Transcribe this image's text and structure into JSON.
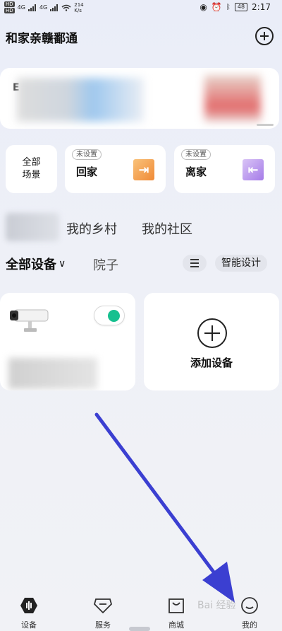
{
  "status_bar": {
    "hd1": "HD",
    "hd2": "HD",
    "net1": "4G",
    "net2": "4G",
    "speed_value": "214",
    "speed_unit": "K/s",
    "battery": "48",
    "time": "2:17"
  },
  "header": {
    "title": "和家亲赣鄱通"
  },
  "banner": {
    "letter": "E"
  },
  "scenes": {
    "all_line1": "全部",
    "all_line2": "场景",
    "home_badge": "未设置",
    "home_label": "回家",
    "leave_badge": "未设置",
    "leave_label": "离家"
  },
  "spaces": {
    "village": "我的乡村",
    "community": "我的社区"
  },
  "device_filter": {
    "all_devices": "全部设备",
    "room": "院子",
    "smart_design": "智能设计"
  },
  "devices": {
    "camera_toggle_on": true,
    "add_label": "添加设备"
  },
  "tabbar": {
    "devices": "设备",
    "service": "服务",
    "mall": "商城",
    "mine": "我的"
  },
  "colors": {
    "accent_green": "#16c08f",
    "arrow": "#3b3fd1"
  }
}
